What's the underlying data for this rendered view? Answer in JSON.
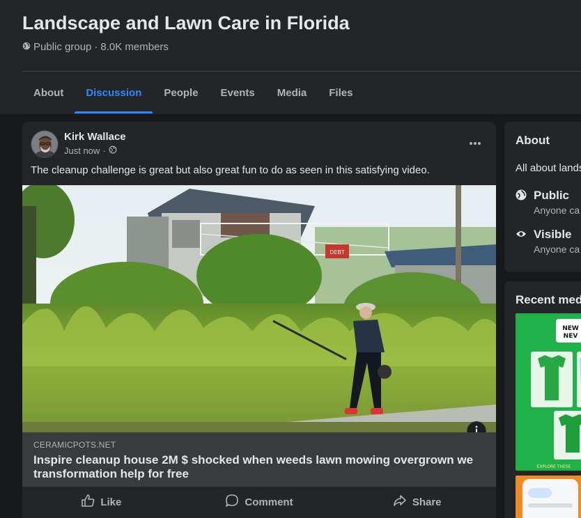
{
  "group": {
    "title": "Landscape and Lawn Care in Florida",
    "privacy": "Public group",
    "separator": "·",
    "members": "8.0K members"
  },
  "tabs": [
    {
      "label": "About",
      "active": false
    },
    {
      "label": "Discussion",
      "active": true
    },
    {
      "label": "People",
      "active": false
    },
    {
      "label": "Events",
      "active": false
    },
    {
      "label": "Media",
      "active": false
    },
    {
      "label": "Files",
      "active": false
    }
  ],
  "post": {
    "author": "Kirk Wallace",
    "time": "Just now",
    "time_separator": "·",
    "text": "The cleanup challenge is great but also great fun to do as seen in this satisfying video.",
    "image_sign_text": "DEBT",
    "link": {
      "domain": "CERAMICPOTS.NET",
      "title": "Inspire cleanup house 2M $ shocked when weeds lawn mowing overgrown we transformation help for free"
    },
    "actions": {
      "like": "Like",
      "comment": "Comment",
      "share": "Share"
    }
  },
  "sidebar": {
    "about": {
      "title": "About",
      "description": "All about lands",
      "items": [
        {
          "label": "Public",
          "sub": "Anyone ca",
          "icon": "globe-icon"
        },
        {
          "label": "Visible",
          "sub": "Anyone ca",
          "icon": "eye-icon"
        }
      ]
    },
    "recent_media": {
      "title": "Recent medi",
      "thumb_text": [
        "NEW",
        "NEV"
      ],
      "thumb_caption": "EXPLORE THESE"
    }
  },
  "colors": {
    "accent": "#2d88ff",
    "card": "#242526",
    "background": "#18191a",
    "text_primary": "#e4e6eb",
    "text_secondary": "#b0b3b8",
    "link_preview": "#3a3b3c"
  }
}
